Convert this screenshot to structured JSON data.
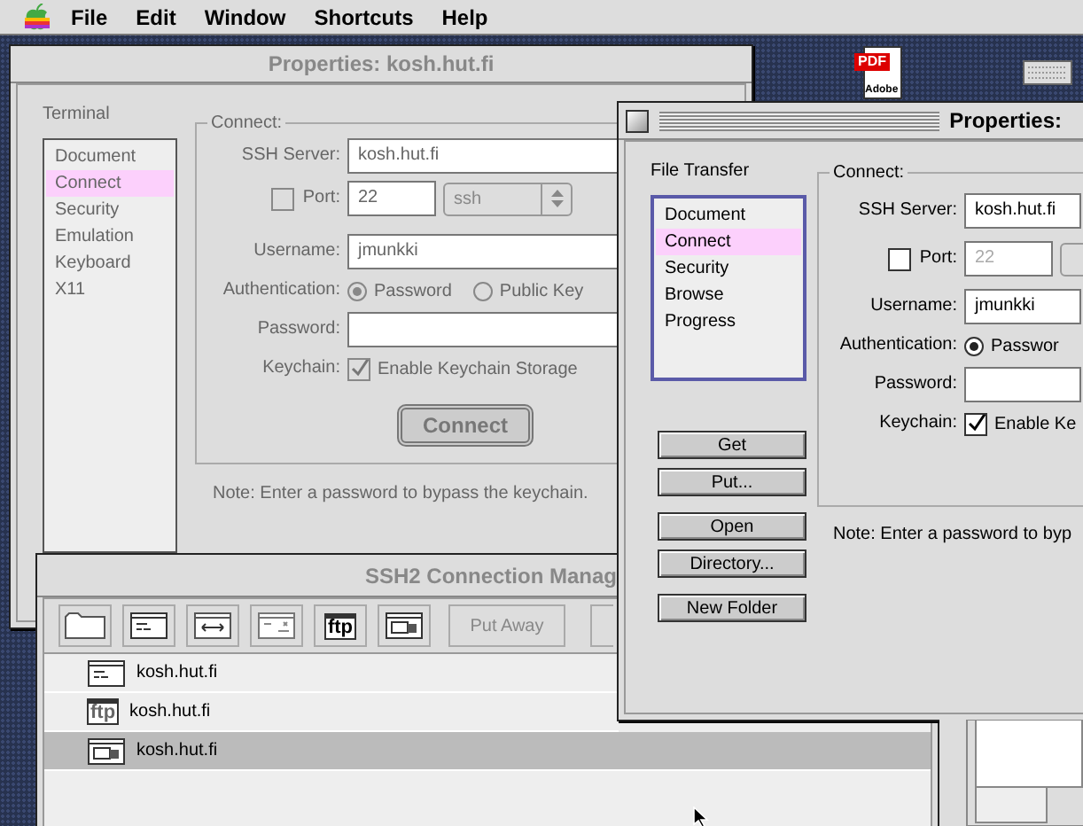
{
  "menu_bar": {
    "items": [
      "File",
      "Edit",
      "Window",
      "Shortcuts",
      "Help"
    ]
  },
  "desktop_icons": [
    {
      "kind": "pdf",
      "badge": "PDF",
      "caption": "Adobe"
    },
    {
      "kind": "keyboard"
    }
  ],
  "windows": [
    {
      "kind": "properties",
      "title": "Properties: kosh.hut.fi",
      "active": false,
      "category": "Terminal",
      "items": [
        {
          "label": "Document",
          "selected": false
        },
        {
          "label": "Connect",
          "selected": true
        },
        {
          "label": "Security",
          "selected": false
        },
        {
          "label": "Emulation",
          "selected": false
        },
        {
          "label": "Keyboard",
          "selected": false
        },
        {
          "label": "X11",
          "selected": false
        }
      ],
      "group_title": "Connect:",
      "ssh_server": {
        "label": "SSH Server:",
        "value": "kosh.hut.fi"
      },
      "port": {
        "label": "Port:",
        "checked": false,
        "value": "22",
        "service": "ssh",
        "disabled": false
      },
      "username": {
        "label": "Username:",
        "value": "jmunkki"
      },
      "authentication": {
        "label": "Authentication:",
        "options": [
          {
            "label": "Password",
            "selected": true
          },
          {
            "label": "Public Key",
            "selected": false
          }
        ]
      },
      "password": {
        "label": "Password:"
      },
      "keychain": {
        "label": "Keychain:",
        "checked": true,
        "text": "Enable Keychain Storage"
      },
      "connect_button": "Connect",
      "note": "Note: Enter a password to bypass the keychain."
    },
    {
      "kind": "manager",
      "title": "SSH2 Connection Manag",
      "active": false,
      "toolbar": [
        {
          "kind": "folder"
        },
        {
          "kind": "terminal"
        },
        {
          "kind": "transfer"
        },
        {
          "kind": "window"
        },
        {
          "kind": "ftp",
          "icon_text": "ftp"
        },
        {
          "kind": "tunnel"
        },
        {
          "kind": "text",
          "label": "Put Away"
        },
        {
          "kind": "text"
        }
      ],
      "rows": [
        {
          "kind": "terminal",
          "label": "kosh.hut.fi",
          "selected": false
        },
        {
          "kind": "ftp",
          "icon_text": "ftp",
          "label": "kosh.hut.fi",
          "selected": false
        },
        {
          "kind": "tunnel",
          "label": "kosh.hut.fi",
          "selected": true
        }
      ]
    },
    {
      "kind": "properties",
      "title": "Properties:",
      "active": true,
      "category": "File Transfer",
      "items": [
        {
          "label": "Document",
          "selected": false
        },
        {
          "label": "Connect",
          "selected": true
        },
        {
          "label": "Security",
          "selected": false
        },
        {
          "label": "Browse",
          "selected": false
        },
        {
          "label": "Progress",
          "selected": false
        }
      ],
      "buttons": [
        "Get",
        "Put...",
        "Open",
        "Directory...",
        "New Folder"
      ],
      "group_title": "Connect:",
      "ssh_server": {
        "label": "SSH Server:",
        "value": "kosh.hut.fi"
      },
      "port": {
        "label": "Port:",
        "checked": false,
        "value": "22",
        "disabled": true
      },
      "username": {
        "label": "Username:",
        "value": "jmunkki"
      },
      "authentication": {
        "label": "Authentication:",
        "options": [
          {
            "label": "Passwor",
            "selected": true
          }
        ]
      },
      "password": {
        "label": "Password:"
      },
      "keychain": {
        "label": "Keychain:",
        "checked": true,
        "text": "Enable Ke"
      },
      "note": "Note: Enter a password to byp"
    }
  ]
}
